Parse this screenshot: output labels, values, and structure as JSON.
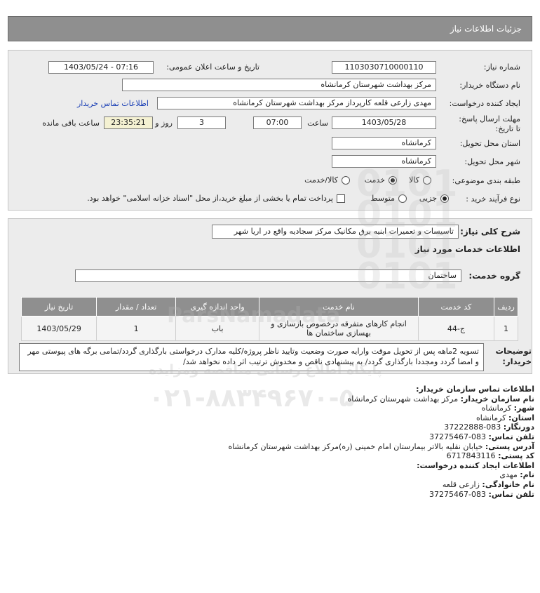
{
  "header": {
    "title": "جزئیات اطلاعات نیاز"
  },
  "form": {
    "need_number": {
      "label": "شماره نیاز:",
      "value": "1103030710000110"
    },
    "announce": {
      "label": "تاریخ و ساعت اعلان عمومی:",
      "value": "1403/05/24 - 07:16"
    },
    "buyer_org": {
      "label": "نام دستگاه خریدار:",
      "value": "مرکز بهداشت شهرستان کرمانشاه"
    },
    "requester": {
      "label": "ایجاد کننده درخواست:",
      "value": "مهدی  زارعی قلعه کارپرداز مرکز بهداشت شهرستان کرمانشاه",
      "contact_link": "اطلاعات تماس خریدار"
    },
    "deadline": {
      "label": "مهلت ارسال پاسخ: تا تاریخ:",
      "date": "1403/05/28",
      "time_label": "ساعت",
      "time": "07:00",
      "days": "3",
      "days_label": "روز و",
      "remaining": "23:35:21",
      "remaining_label": "ساعت باقی مانده"
    },
    "province": {
      "label": "استان محل تحویل:",
      "value": "کرمانشاه"
    },
    "city": {
      "label": "شهر محل تحویل:",
      "value": "کرمانشاه"
    },
    "category": {
      "label": "طبقه بندی موضوعی:",
      "options": [
        "کالا",
        "خدمت",
        "کالا/خدمت"
      ],
      "selected": "خدمت"
    },
    "process": {
      "label": "نوع فرآیند خرید :",
      "options": [
        "جزیی",
        "متوسط"
      ],
      "selected": "جزیی",
      "checkbox_label": "پرداخت تمام یا بخشی از مبلغ خرید،از محل \"اسناد خزانه اسلامی\" خواهد بود.",
      "checkbox_checked": false
    }
  },
  "description": {
    "label": "شرح کلی نیاز:",
    "value": "تاسیسات و تعمیرات ابنیه برق مکانیک مرکز سجادیه واقع در اریا شهر"
  },
  "services": {
    "heading": "اطلاعات خدمات مورد نیاز",
    "group_label": "گروه خدمت:",
    "group_value": "ساختمان",
    "columns": [
      "ردیف",
      "کد خدمت",
      "نام خدمت",
      "واحد اندازه گیری",
      "تعداد / مقدار",
      "تاریخ نیاز"
    ],
    "rows": [
      {
        "row": "1",
        "code": "ج-44",
        "name": "انجام کارهای متفرقه درخصوص بازسازی و بهسازی ساختمان ها",
        "unit": "باب",
        "qty": "1",
        "date": "1403/05/29"
      }
    ]
  },
  "notes": {
    "label": "توضیحات خریدار:",
    "value": "تسویه 2ماهه پس از تحویل موقت وارایه صورت وضعیت وتایید ناظر پروژه/کلیه مدارک درخواستی بارگذاری گردد/تمامی برگه های پیوستی مهر و امضا گردد ومجددا بارگذاری گردد/ به پیشنهادی ناقص و مخدوش ترتیب اثر داده نخواهد شد/"
  },
  "contact": {
    "buyer_heading": "اطلاعات تماس سازمان خریدار:",
    "org_name": {
      "label": "نام سازمان خریدار:",
      "value": "مرکز بهداشت شهرستان کرمانشاه"
    },
    "city": {
      "label": "شهر:",
      "value": "کرمانشاه"
    },
    "province": {
      "label": "استان:",
      "value": "کرمانشاه"
    },
    "fax": {
      "label": "دورنگار:",
      "value": "083-37222888"
    },
    "phone": {
      "label": "تلفن تماس:",
      "value": "083-37275467"
    },
    "address": {
      "label": "آدرس پستی:",
      "value": "خیابان نقلیه بالاتر بیمارستان امام خمینی (ره)مرکز بهداشت شهرستان کرمانشاه"
    },
    "postal": {
      "label": "کد پستی:",
      "value": "6717843116"
    },
    "creator_heading": "اطلاعات ایجاد کننده درخواست:",
    "first_name": {
      "label": "نام:",
      "value": "مهدی"
    },
    "last_name": {
      "label": "نام خانوادگی:",
      "value": "زارعی قلعه"
    },
    "creator_phone": {
      "label": "تلفن تماس:",
      "value": "083-37275467"
    }
  },
  "watermark": {
    "brand": "ParsNamadata",
    "tagline": "پایگاه اطلاع رسانی مناقصه ومزایده",
    "phone": "۰۲۱-۸۸۳۴۹۶۷۰-۵"
  }
}
